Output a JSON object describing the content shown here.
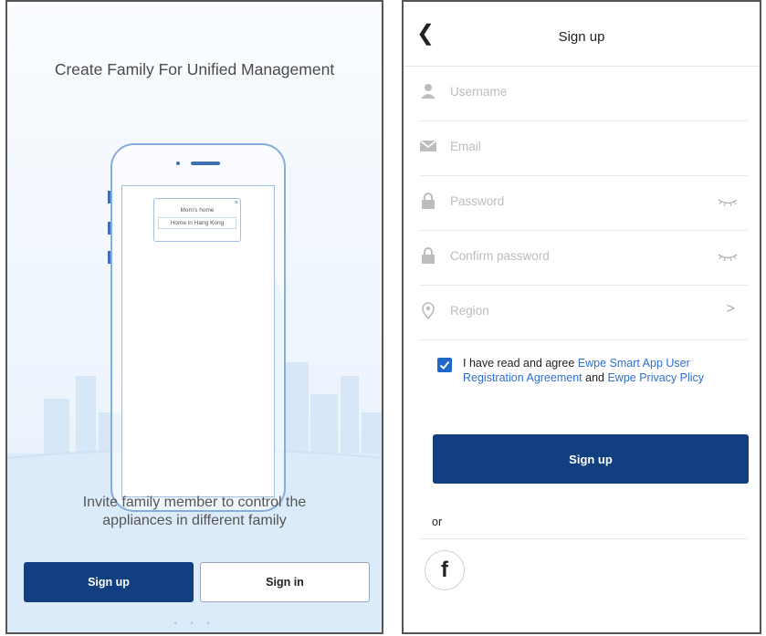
{
  "left": {
    "headline": "Create Family For Unified Management",
    "popup": {
      "item1": "Mom's home",
      "item2": "Home in Hang Kong"
    },
    "invite_line1": "Invite family member to control the",
    "invite_line2": "appliances in different family",
    "signup_label": "Sign up",
    "signin_label": "Sign in",
    "pager_dots": "• • •"
  },
  "right": {
    "back_icon": "chevron-left-icon",
    "title": "Sign up",
    "fields": [
      {
        "icon": "user-icon",
        "placeholder": "Username"
      },
      {
        "icon": "envelope-icon",
        "placeholder": "Email"
      },
      {
        "icon": "lock-icon",
        "placeholder": "Password",
        "trailing": "eye-closed-icon"
      },
      {
        "icon": "lock-icon",
        "placeholder": "Confirm password",
        "trailing": "eye-closed-icon"
      },
      {
        "icon": "location-pin-icon",
        "placeholder": "Region",
        "trailing": "chevron-right-icon"
      }
    ],
    "agreement": {
      "checked": true,
      "prefix": "I have read and agree",
      "link1": "Ewpe Smart App User Registration Agreement",
      "and": "and",
      "link2": "Ewpe Privacy Plicy"
    },
    "signup_label": "Sign up",
    "or_label": "or",
    "social_icon": "facebook-icon",
    "social_letter": "f"
  },
  "colors": {
    "primary": "#123f80",
    "link": "#2f6fd0",
    "checkbox": "#1f67c8",
    "illustration": "#86aedc"
  }
}
